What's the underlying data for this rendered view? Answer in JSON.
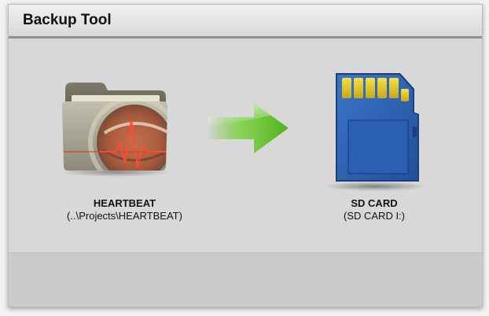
{
  "window": {
    "title": "Backup Tool"
  },
  "source": {
    "name": "HEARTBEAT",
    "path": "(..\\Projects\\HEARTBEAT)",
    "icon": "folder-heartbeat-icon"
  },
  "transfer": {
    "icon": "arrow-right-icon",
    "color": "#5ec11f"
  },
  "destination": {
    "name": "SD CARD",
    "path": "(SD CARD I:)",
    "icon": "sd-card-icon",
    "color": "#2f64b8"
  },
  "footer": {}
}
